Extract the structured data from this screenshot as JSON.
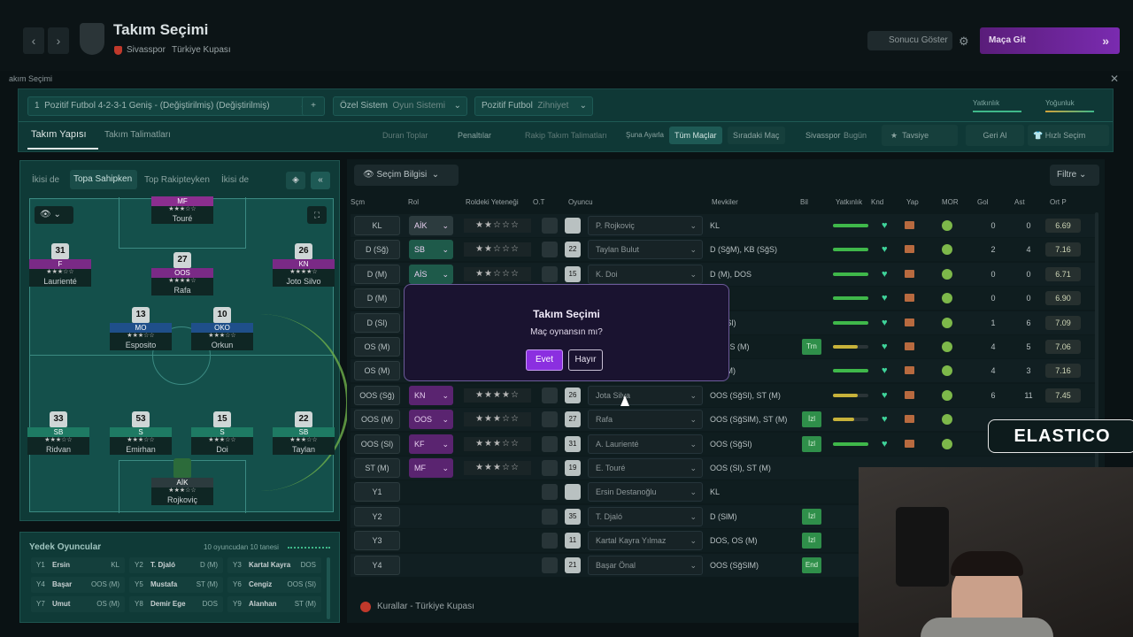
{
  "header": {
    "title": "Takım Seçimi",
    "club": "Sivasspor",
    "competition": "Türkiye Kupası",
    "sonucu": "Sonucu Göster",
    "macagit": "Maça Git",
    "breadcrumb": "akım Seçimi"
  },
  "tactic": {
    "formation": "Pozitif Futbol 4-2-3-1 Geniş - (Değiştirilmiş) (Değiştirilmiş)",
    "system_label": "Özel Sistem",
    "system_value": "Oyun Sistemi",
    "mentality_label": "Pozitif Futbol",
    "mentality_value": "Zihniyet",
    "yatkinlik": "Yatkınlık",
    "yogunluk": "Yoğunluk",
    "number": "1",
    "plus": "+"
  },
  "tabs": {
    "structure": "Takım Yapısı",
    "instructions": "Takım Talimatları",
    "duran": "Duran Toplar",
    "penalti": "Penaltılar",
    "rakip": "Rakip Takım Talimatları",
    "suna": "Şuna Ayarla",
    "tum": "Tüm Maçlar",
    "siradaki": "Sıradaki Maç",
    "team_short": "Sivasspor",
    "today": "Bugün",
    "tavsiye": "Tavsiye",
    "geri": "Geri Al",
    "hizli": "Hızlı Seçim"
  },
  "pitch_tabs": [
    "İkisi de",
    "Topa Sahipken",
    "Top Rakipteyken",
    "İkisi de"
  ],
  "pitch_players": [
    {
      "num": "",
      "pos": "MF",
      "stars": "★★★☆☆",
      "name": "Touré"
    },
    {
      "num": "31",
      "pos": "F",
      "stars": "★★★☆☆",
      "name": "Laurienté"
    },
    {
      "num": "27",
      "pos": "OOS",
      "stars": "★★★★☆",
      "name": "Rafa"
    },
    {
      "num": "26",
      "pos": "KN",
      "stars": "★★★★☆",
      "name": "Joto Silvo"
    },
    {
      "num": "13",
      "pos": "MO",
      "stars": "★★★☆☆",
      "name": "Esposito"
    },
    {
      "num": "10",
      "pos": "OKO",
      "stars": "★★★☆☆",
      "name": "Orkun"
    },
    {
      "num": "33",
      "pos": "SB",
      "stars": "★★★☆☆",
      "name": "Ridvan"
    },
    {
      "num": "53",
      "pos": "S",
      "stars": "★★★☆☆",
      "name": "Emirhan"
    },
    {
      "num": "15",
      "pos": "S",
      "stars": "★★★☆☆",
      "name": "Doi"
    },
    {
      "num": "22",
      "pos": "SB",
      "stars": "★★★☆☆",
      "name": "Taylan"
    },
    {
      "num": "",
      "pos": "AİK",
      "stars": "★★★☆☆",
      "name": "Rojkoviç"
    }
  ],
  "bench": {
    "title": "Yedek Oyuncular",
    "count": "10 oyuncudan 10 tanesi",
    "items": [
      {
        "slot": "Y1",
        "name": "Ersin",
        "pos": "KL"
      },
      {
        "slot": "Y2",
        "name": "T. Djaló",
        "pos": "D (M)"
      },
      {
        "slot": "Y3",
        "name": "Kartal Kayra",
        "pos": "DOS"
      },
      {
        "slot": "Y4",
        "name": "Başar",
        "pos": "OOS (M)"
      },
      {
        "slot": "Y5",
        "name": "Mustafa",
        "pos": "ST (M)"
      },
      {
        "slot": "Y6",
        "name": "Cengiz",
        "pos": "OOS (Sl)"
      },
      {
        "slot": "Y7",
        "name": "Umut",
        "pos": "OS (M)"
      },
      {
        "slot": "Y8",
        "name": "Demir Ege",
        "pos": "DOS"
      },
      {
        "slot": "Y9",
        "name": "Alanhan",
        "pos": "ST (M)"
      }
    ]
  },
  "table": {
    "info_btn": "Seçim Bilgisi",
    "filter": "Filtre",
    "headers": [
      "Sçm",
      "Rol",
      "Roldeki Yeteneği",
      "O.T",
      "Oyuncu",
      "Mevkiler",
      "Bil",
      "Yatkınlık",
      "Knd",
      "Yap",
      "MOR",
      "Gol",
      "Ast",
      "Ort P"
    ],
    "rows": [
      {
        "slot": "KL",
        "role": "AİK",
        "stars": "★★☆☆☆",
        "num": "",
        "player": "P. Rojkoviç",
        "mev": "KL",
        "gol": "0",
        "ast": "0",
        "op": "6.69",
        "bil": ""
      },
      {
        "slot": "D (Sğ)",
        "role": "SB",
        "stars": "★★☆☆☆",
        "num": "22",
        "player": "Taylan Bulut",
        "mev": "D (SğM), KB (SğS)",
        "gol": "2",
        "ast": "4",
        "op": "7.16",
        "bil": ""
      },
      {
        "slot": "D (M)",
        "role": "AİS",
        "stars": "★★☆☆☆",
        "num": "15",
        "player": "K. Doi",
        "mev": "D (M), DOS",
        "gol": "0",
        "ast": "0",
        "op": "6.71",
        "bil": ""
      },
      {
        "slot": "D (M)",
        "role": "",
        "stars": "",
        "num": "",
        "player": "",
        "mev": ")",
        "gol": "0",
        "ast": "0",
        "op": "6.90",
        "bil": ""
      },
      {
        "slot": "D (Sl)",
        "role": "",
        "stars": "",
        "num": "",
        "player": "",
        "mev": "OS (Sl)",
        "gol": "1",
        "ast": "6",
        "op": "7.09",
        "bil": ""
      },
      {
        "slot": "OS (M)",
        "role": "",
        "stars": "",
        "num": "",
        "player": "",
        "mev": "S/OOS (M)",
        "gol": "4",
        "ast": "5",
        "op": "7.06",
        "bil": "Trn"
      },
      {
        "slot": "OS (M)",
        "role": "",
        "stars": "",
        "num": "",
        "player": "",
        "mev": "OS (M)",
        "gol": "4",
        "ast": "3",
        "op": "7.16",
        "bil": ""
      },
      {
        "slot": "OOS (Sğ)",
        "role": "KN",
        "stars": "★★★★☆",
        "num": "26",
        "player": "Jota Silva",
        "mev": "OOS (SğSl), ST (M)",
        "gol": "6",
        "ast": "11",
        "op": "7.45",
        "bil": ""
      },
      {
        "slot": "OOS (M)",
        "role": "OOS",
        "stars": "★★★☆☆",
        "num": "27",
        "player": "Rafa",
        "mev": "OOS (SğSlM), ST (M)",
        "gol": "",
        "ast": "",
        "op": "",
        "bil": "İzl"
      },
      {
        "slot": "OOS (Sl)",
        "role": "KF",
        "stars": "★★★☆☆",
        "num": "31",
        "player": "A. Laurienté",
        "mev": "OOS (SğSl)",
        "gol": "",
        "ast": "",
        "op": "",
        "bil": "İzl"
      },
      {
        "slot": "ST (M)",
        "role": "MF",
        "stars": "★★★☆☆",
        "num": "19",
        "player": "E. Touré",
        "mev": "OOS (Sl), ST (M)",
        "gol": "",
        "ast": "",
        "op": "",
        "bil": ""
      },
      {
        "slot": "Y1",
        "role": "",
        "stars": "",
        "num": "",
        "player": "Ersin Destanoğlu",
        "mev": "KL",
        "gol": "",
        "ast": "",
        "op": "",
        "bil": ""
      },
      {
        "slot": "Y2",
        "role": "",
        "stars": "",
        "num": "35",
        "player": "T. Djaló",
        "mev": "D (SlM)",
        "gol": "",
        "ast": "",
        "op": "",
        "bil": "İzl"
      },
      {
        "slot": "Y3",
        "role": "",
        "stars": "",
        "num": "11",
        "player": "Kartal Kayra Yılmaz",
        "mev": "DOS, OS (M)",
        "gol": "",
        "ast": "",
        "op": "",
        "bil": "İzl"
      },
      {
        "slot": "Y4",
        "role": "",
        "stars": "",
        "num": "21",
        "player": "Başar Önal",
        "mev": "OOS (SğSlM)",
        "gol": "",
        "ast": "",
        "op": "",
        "bil": "End"
      }
    ]
  },
  "footer": "Kurallar - Türkiye Kupası",
  "modal": {
    "title": "Takım Seçimi",
    "question": "Maç oynansın mı?",
    "yes": "Evet",
    "no": "Hayır"
  },
  "overlay": {
    "brand": "ELASTICO"
  }
}
